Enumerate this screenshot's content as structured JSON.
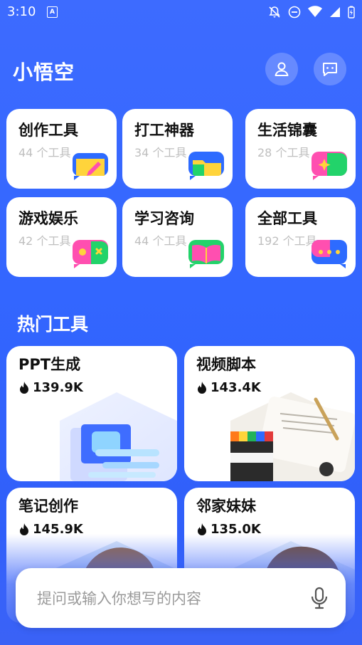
{
  "status": {
    "time": "3:10",
    "sim_glyph": "A"
  },
  "app": {
    "title": "小悟空"
  },
  "categories": [
    {
      "name": "创作工具",
      "count": "44 个工具",
      "icon": "pencil-card-icon"
    },
    {
      "name": "打工神器",
      "count": "34 个工具",
      "icon": "folder-icon"
    },
    {
      "name": "生活锦囊",
      "count": "28 个工具",
      "icon": "sparkle-ticket-icon"
    },
    {
      "name": "游戏娱乐",
      "count": "42 个工具",
      "icon": "game-icon"
    },
    {
      "name": "学习咨询",
      "count": "44 个工具",
      "icon": "open-book-icon"
    },
    {
      "name": "全部工具",
      "count": "192 个工具",
      "icon": "chat-dots-icon"
    }
  ],
  "hot": {
    "title": "热门工具",
    "items": [
      {
        "name": "PPT生成",
        "stat": "139.9K"
      },
      {
        "name": "视频脚本",
        "stat": "143.4K"
      },
      {
        "name": "笔记创作",
        "stat": "145.9K"
      },
      {
        "name": "邻家妹妹",
        "stat": "135.0K"
      }
    ]
  },
  "input": {
    "placeholder": "提问或输入你想写的内容",
    "value": ""
  },
  "colors": {
    "background": "#3366ff",
    "card": "#ffffff",
    "accent_blue": "#2d6bff",
    "accent_pink": "#ff4fb0",
    "accent_green": "#22d36a",
    "accent_yellow": "#ffd43b"
  }
}
